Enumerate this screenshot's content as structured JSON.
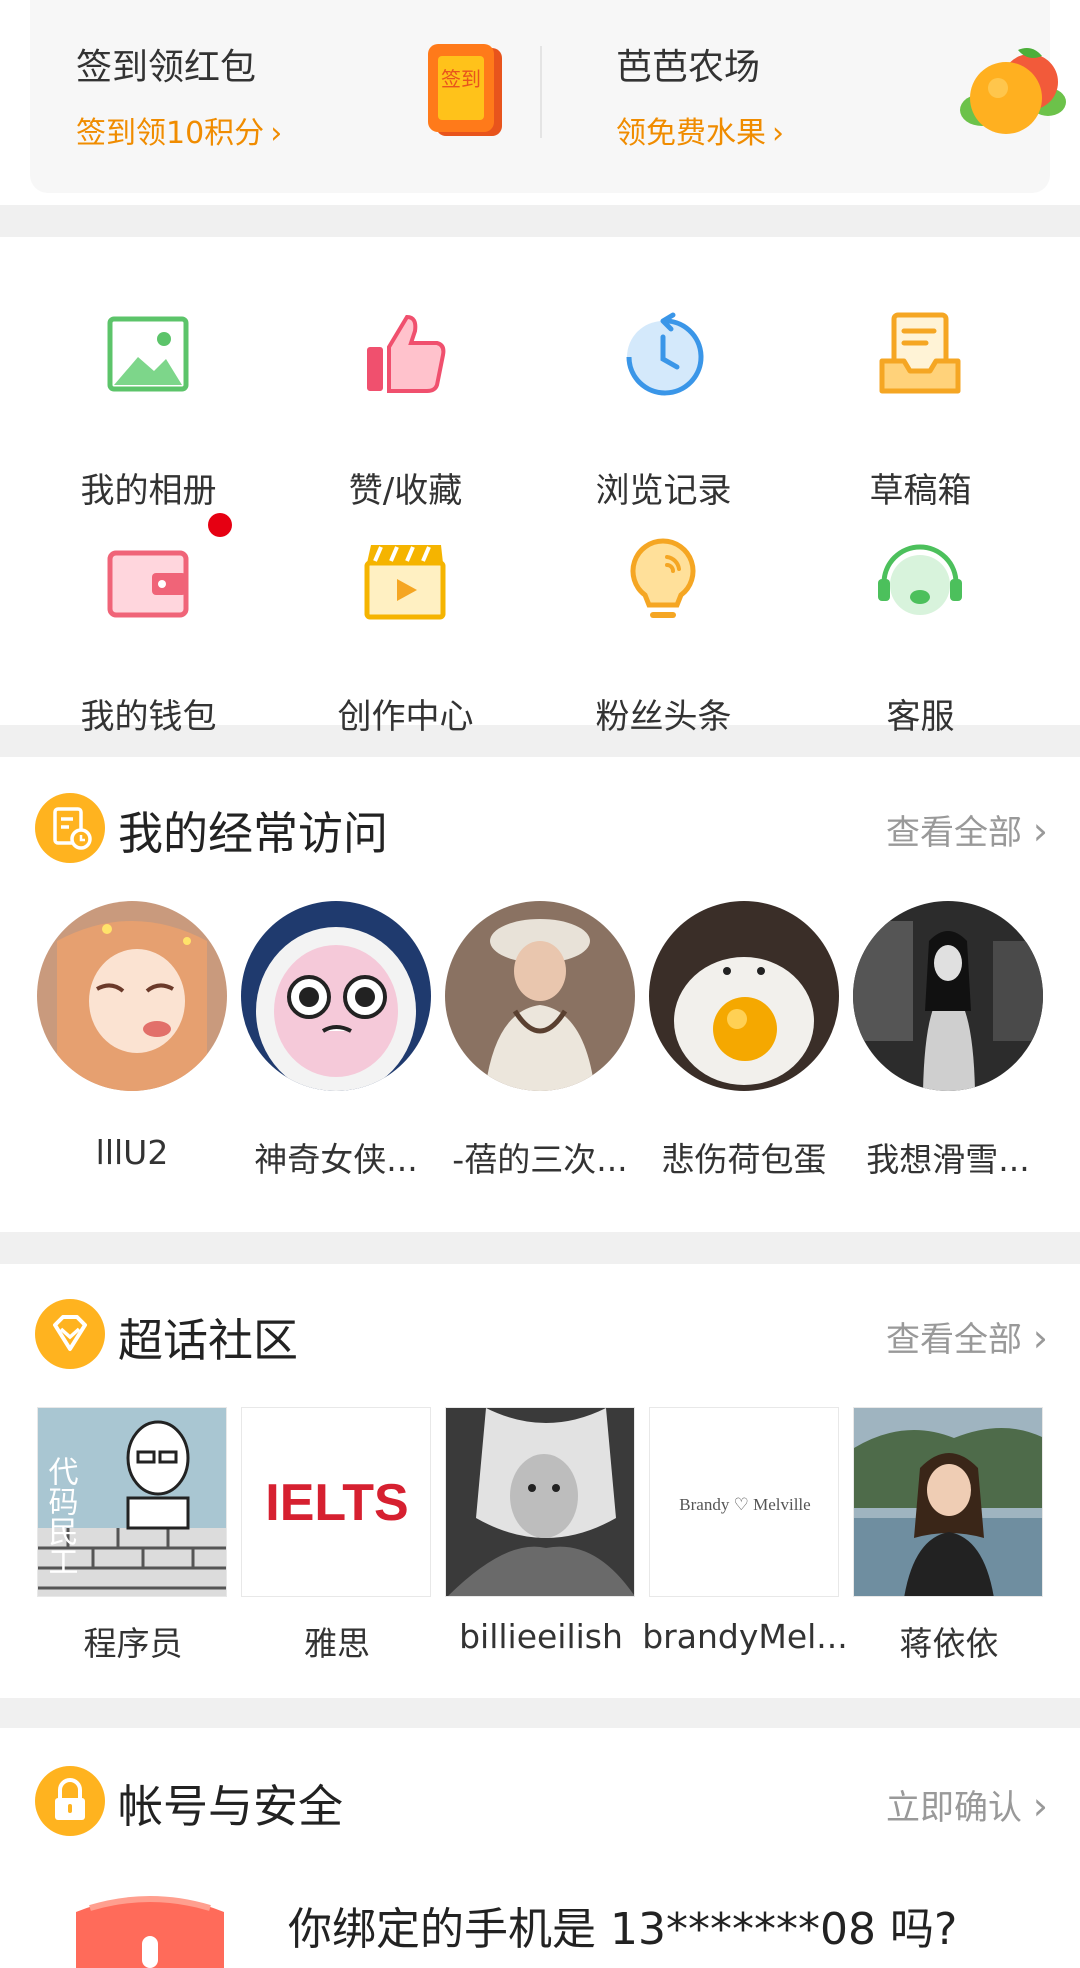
{
  "promo": {
    "checkin": {
      "title": "签到领红包",
      "subtitle": "签到领10积分",
      "badge": "签到"
    },
    "farm": {
      "title": "芭芭农场",
      "subtitle": "领免费水果"
    },
    "chevron": "›"
  },
  "grid": [
    {
      "label": "我的相册",
      "icon": "photo-album-icon",
      "color": "#5cc46a"
    },
    {
      "label": "赞/收藏",
      "icon": "thumbs-up-icon",
      "color": "#f0506e"
    },
    {
      "label": "浏览记录",
      "icon": "history-clock-icon",
      "color": "#3a96e8"
    },
    {
      "label": "草稿箱",
      "icon": "drafts-tray-icon",
      "color": "#f5a623"
    },
    {
      "label": "我的钱包",
      "icon": "wallet-icon",
      "color": "#f06478",
      "has_badge": true
    },
    {
      "label": "创作中心",
      "icon": "clapperboard-icon",
      "color": "#f5b400"
    },
    {
      "label": "粉丝头条",
      "icon": "lightbulb-icon",
      "color": "#f5a623"
    },
    {
      "label": "客服",
      "icon": "headset-icon",
      "color": "#4cc05c"
    }
  ],
  "frequent": {
    "title": "我的经常访问",
    "more": "查看全部",
    "items": [
      "lllU2",
      "神奇女侠...",
      "-蓓的三次...",
      "悲伤荷包蛋",
      "我想滑雪..."
    ]
  },
  "topics": {
    "title": "超话社区",
    "more": "查看全部",
    "items": [
      "程序员",
      "雅思",
      "billieeilish",
      "brandyMel...",
      "蒋依依"
    ],
    "thumb_texts": {
      "coder": "代码民工",
      "ielts": "IELTS",
      "brandy": "Brandy ♡ Melville"
    }
  },
  "security": {
    "title": "帐号与安全",
    "action": "立即确认",
    "prompt": "你绑定的手机是 13*******08 吗?"
  },
  "colors": {
    "accent_orange": "#f08c00",
    "section_bg": "#f0f0f0",
    "badge_red": "#e60012"
  }
}
